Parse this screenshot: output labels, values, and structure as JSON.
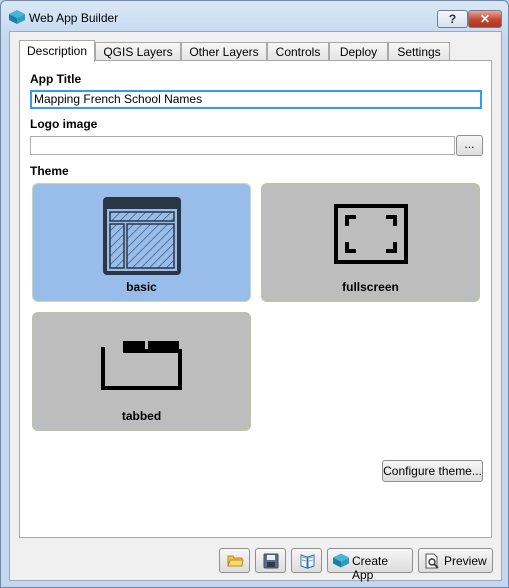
{
  "window": {
    "title": "Web App Builder",
    "help_label": "?",
    "close_label": "✕"
  },
  "tabs": [
    {
      "label": "Description",
      "active": true
    },
    {
      "label": "QGIS Layers",
      "active": false
    },
    {
      "label": "Other Layers",
      "active": false
    },
    {
      "label": "Controls",
      "active": false
    },
    {
      "label": "Deploy",
      "active": false
    },
    {
      "label": "Settings",
      "active": false
    }
  ],
  "description": {
    "app_title_label": "App Title",
    "app_title_value": "Mapping French School Names",
    "logo_label": "Logo image",
    "logo_value": "",
    "browse_label": "...",
    "theme_label": "Theme",
    "themes": [
      {
        "name": "basic",
        "selected": true
      },
      {
        "name": "fullscreen",
        "selected": false
      },
      {
        "name": "tabbed",
        "selected": false
      }
    ],
    "configure_theme_label": "Configure theme..."
  },
  "footer": {
    "open_icon": "folder-icon",
    "save_icon": "floppy-disk-icon",
    "help_icon": "book-icon",
    "create_app_label": "Create App",
    "preview_label": "Preview"
  },
  "colors": {
    "selected_theme": "#98bdea",
    "unselected_theme": "#bdbdbd",
    "focus_border": "#3399ff"
  }
}
